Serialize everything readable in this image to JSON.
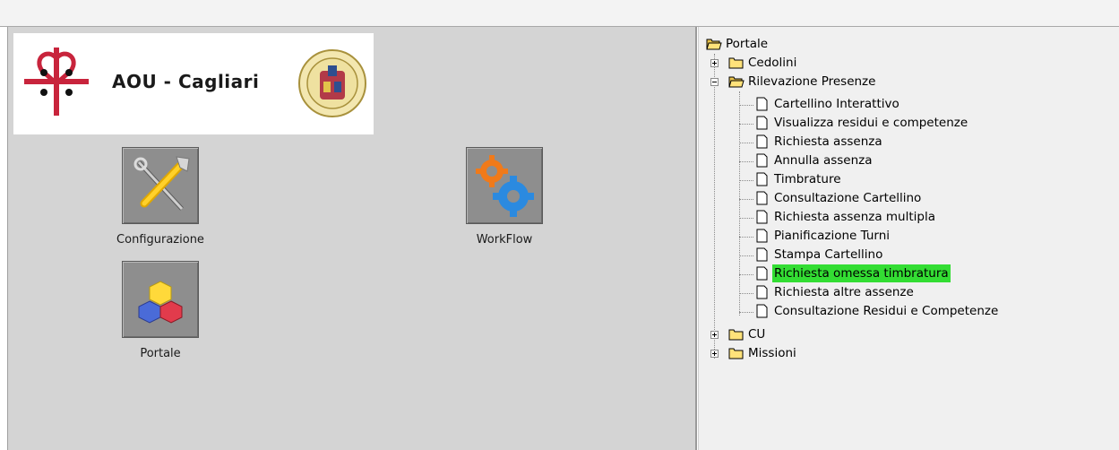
{
  "logo": {
    "text": "AOU - Cagliari"
  },
  "launchers": [
    {
      "label": "Configurazione",
      "icon": "tools-icon"
    },
    {
      "label": "WorkFlow",
      "icon": "gears-icon"
    },
    {
      "label": "Portale",
      "icon": "cubes-icon"
    }
  ],
  "tree": {
    "root": "Portale",
    "cedolini": "Cedolini",
    "rilevazione": "Rilevazione Presenze",
    "items": [
      "Cartellino Interattivo",
      "Visualizza residui e competenze",
      "Richiesta assenza",
      "Annulla assenza",
      "Timbrature",
      "Consultazione Cartellino",
      "Richiesta assenza multipla",
      "Pianificazione Turni",
      "Stampa Cartellino",
      "Richiesta omessa timbratura",
      "Richiesta altre assenze",
      "Consultazione Residui e Competenze"
    ],
    "cu": "CU",
    "missioni": "Missioni",
    "selected_item": "Richiesta omessa timbratura"
  },
  "colors": {
    "selection": "#33dd33",
    "panel": "#d4d4d4"
  }
}
